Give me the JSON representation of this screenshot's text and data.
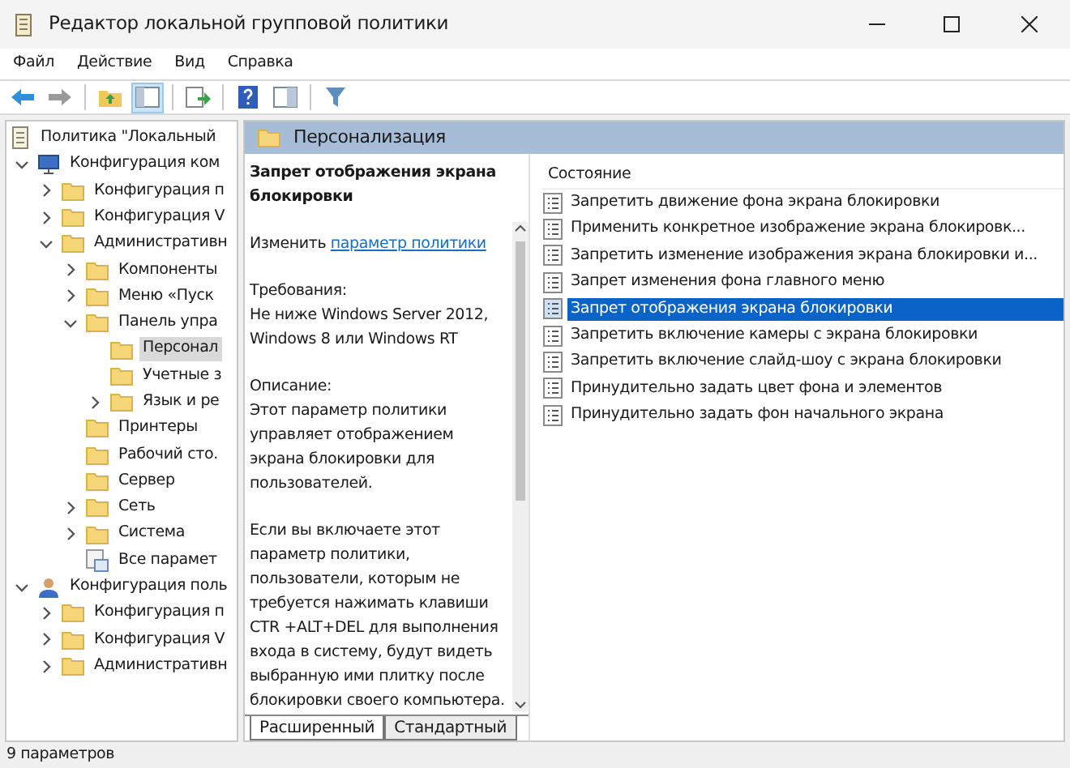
{
  "window": {
    "title": "Редактор локальной групповой политики"
  },
  "menu": [
    "Файл",
    "Действие",
    "Вид",
    "Справка"
  ],
  "toolbar": [
    [
      {
        "kind": "back",
        "pressed": false
      },
      {
        "kind": "forward",
        "pressed": false
      }
    ],
    [
      {
        "kind": "up",
        "pressed": false
      },
      {
        "kind": "tree",
        "pressed": true
      }
    ],
    [
      {
        "kind": "export",
        "pressed": false
      }
    ],
    [
      {
        "kind": "help",
        "pressed": false
      },
      {
        "kind": "view",
        "pressed": false
      }
    ],
    [
      {
        "kind": "filter",
        "pressed": false
      }
    ]
  ],
  "tree": [
    {
      "label": "Политика \"Локальный",
      "kind": "policy",
      "selected": false,
      "children": [
        {
          "label": "Конфигурация ком",
          "kind": "computer",
          "expanded": true,
          "selected": false,
          "children": [
            {
              "label": "Конфигурация п",
              "kind": "folder",
              "expanded": false,
              "selected": false
            },
            {
              "label": "Конфигурация V",
              "kind": "folder",
              "expanded": false,
              "selected": false
            },
            {
              "label": "Административн",
              "kind": "folder",
              "expanded": true,
              "selected": false,
              "children": [
                {
                  "label": "Компоненты",
                  "kind": "folder",
                  "expanded": false,
                  "selected": false
                },
                {
                  "label": "Меню «Пуск",
                  "kind": "folder",
                  "expanded": false,
                  "selected": false
                },
                {
                  "label": "Панель упра",
                  "kind": "folder",
                  "expanded": true,
                  "selected": false,
                  "children": [
                    {
                      "label": "Персонал",
                      "kind": "folder",
                      "selected": true
                    },
                    {
                      "label": "Учетные з",
                      "kind": "folder",
                      "selected": false
                    },
                    {
                      "label": "Язык и ре",
                      "kind": "folder",
                      "expanded": false,
                      "selected": false
                    }
                  ]
                },
                {
                  "label": "Принтеры",
                  "kind": "folder",
                  "selected": false
                },
                {
                  "label": "Рабочий сто.",
                  "kind": "folder",
                  "selected": false
                },
                {
                  "label": "Сервер",
                  "kind": "folder",
                  "selected": false
                },
                {
                  "label": "Сеть",
                  "kind": "folder",
                  "expanded": false,
                  "selected": false
                },
                {
                  "label": "Система",
                  "kind": "folder",
                  "expanded": false,
                  "selected": false
                },
                {
                  "label": "Все парамет",
                  "kind": "settings",
                  "selected": false
                }
              ]
            }
          ]
        },
        {
          "label": "Конфигурация поль",
          "kind": "user",
          "expanded": true,
          "selected": false,
          "children": [
            {
              "label": "Конфигурация п",
              "kind": "folder",
              "expanded": false,
              "selected": false
            },
            {
              "label": "Конфигурация V",
              "kind": "folder",
              "expanded": false,
              "selected": false
            },
            {
              "label": "Административн",
              "kind": "folder",
              "expanded": false,
              "selected": false
            }
          ]
        }
      ]
    }
  ],
  "header": {
    "title": "Персонализация"
  },
  "description": {
    "title": "Запрет отображения экрана блокировки",
    "edit_prefix": "Изменить",
    "edit_link": "параметр политики",
    "requirements_label": "Требования:",
    "requirements": "Не ниже Windows Server 2012, Windows 8 или Windows RT",
    "description_label": "Описание:",
    "paragraphs": [
      "Этот параметр политики управляет отображением экрана блокировки для пользователей.",
      "Если вы включаете этот параметр политики, пользователи, которым не требуется нажимать клавиши CTR +ALT+DEL для выполнения входа в систему, будут видеть выбранную ими плитку после блокировки своего компьютера."
    ]
  },
  "list": {
    "column": "Состояние",
    "items": [
      {
        "label": "Запретить движение фона экрана блокировки",
        "selected": false
      },
      {
        "label": "Применить конкретное изображение экрана блокировк...",
        "selected": false
      },
      {
        "label": "Запретить изменение изображения экрана блокировки и...",
        "selected": false
      },
      {
        "label": "Запрет изменения фона главного меню",
        "selected": false
      },
      {
        "label": "Запрет отображения экрана блокировки",
        "selected": true
      },
      {
        "label": "Запретить включение камеры с экрана блокировки",
        "selected": false
      },
      {
        "label": "Запретить включение слайд-шоу с экрана блокировки",
        "selected": false
      },
      {
        "label": "Принудительно задать цвет фона и элементов",
        "selected": false
      },
      {
        "label": "Принудительно задать фон начального экрана",
        "selected": false
      }
    ]
  },
  "tabs": [
    {
      "label": "Расширенный",
      "selected": true
    },
    {
      "label": "Стандартный",
      "selected": false
    }
  ],
  "status_bar": "9 параметров"
}
